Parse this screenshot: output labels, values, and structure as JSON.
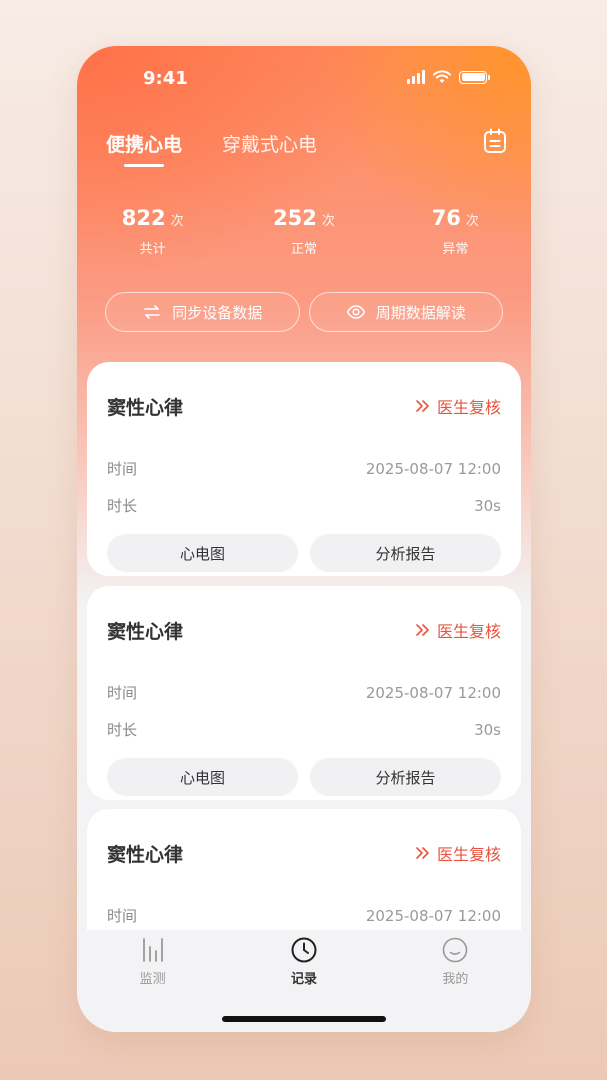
{
  "status_bar": {
    "time": "9:41"
  },
  "tabs": [
    {
      "label": "便携心电",
      "active": true
    },
    {
      "label": "穿戴式心电",
      "active": false
    }
  ],
  "header_icon": "calendar-icon",
  "stats": [
    {
      "value": "822",
      "unit": "次",
      "label": "共计"
    },
    {
      "value": "252",
      "unit": "次",
      "label": "正常"
    },
    {
      "value": "76",
      "unit": "次",
      "label": "异常"
    }
  ],
  "actions": {
    "sync": {
      "label": "同步设备数据",
      "icon": "sync-icon"
    },
    "period": {
      "label": "周期数据解读",
      "icon": "eye-icon"
    }
  },
  "records": [
    {
      "title": "窦性心律",
      "review": "医生复核",
      "time_label": "时间",
      "time_value": "2025-08-07 12:00",
      "duration_label": "时长",
      "duration_value": "30s",
      "btn_ecg": "心电图",
      "btn_report": "分析报告"
    },
    {
      "title": "窦性心律",
      "review": "医生复核",
      "time_label": "时间",
      "time_value": "2025-08-07 12:00",
      "duration_label": "时长",
      "duration_value": "30s",
      "btn_ecg": "心电图",
      "btn_report": "分析报告"
    },
    {
      "title": "窦性心律",
      "review": "医生复核",
      "time_label": "时间",
      "time_value": "2025-08-07 12:00"
    }
  ],
  "tabbar": [
    {
      "label": "监测",
      "icon": "monitor-icon",
      "active": false
    },
    {
      "label": "记录",
      "icon": "clock-icon",
      "active": true
    },
    {
      "label": "我的",
      "icon": "profile-face-icon",
      "active": false
    }
  ],
  "colors": {
    "accent": "#e8533e",
    "hero_orange": "#ff8a5c",
    "hero_amber": "#ff9a30"
  }
}
